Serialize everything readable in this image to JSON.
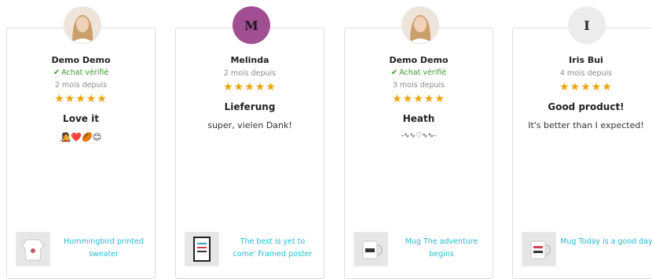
{
  "reviews": [
    {
      "reviewer": "Demo Demo",
      "avatar": {
        "kind": "photo"
      },
      "verified": "Achat vérifié",
      "date": "2 mois depuis",
      "rating": 5,
      "stars": "★★★★★",
      "title": "Love it",
      "body": "🧑‍🎤❤️🏉😊",
      "product": "Hummingbird printed sweater",
      "product_icon": "sweater-thumbnail"
    },
    {
      "reviewer": "Melinda",
      "avatar": {
        "kind": "letter",
        "initial": "M",
        "bg": "#a14e93",
        "fg": "#1b1b1b"
      },
      "date": "2 mois depuis",
      "rating": 5,
      "stars": "★★★★★",
      "title": "Lieferung",
      "body": "super, vielen Dank!",
      "product": "The best is yet to come' Framed poster",
      "product_icon": "framed-poster-thumbnail"
    },
    {
      "reviewer": "Demo Demo",
      "avatar": {
        "kind": "photo"
      },
      "verified": "Achat vérifié",
      "date": "3 mois depuis",
      "rating": 5,
      "stars": "★★★★★",
      "title": "Heath",
      "body": "-∿∿♡∿∿-",
      "product": "Mug The adventure begins",
      "product_icon": "mug-thumbnail"
    },
    {
      "reviewer": "Iris Bui",
      "avatar": {
        "kind": "letter",
        "initial": "I",
        "bg": "#ececec",
        "fg": "#222222"
      },
      "date": "4 mois depuis",
      "rating": 5,
      "stars": "★★★★★",
      "title": "Good product!",
      "body": "It's better than I expected!",
      "product": "Mug Today is a good day",
      "product_icon": "mug-thumbnail"
    }
  ],
  "colors": {
    "star": "#f0a10a",
    "verified": "#3a9a2b",
    "link": "#25b9d7",
    "border": "#dcdcdc"
  }
}
